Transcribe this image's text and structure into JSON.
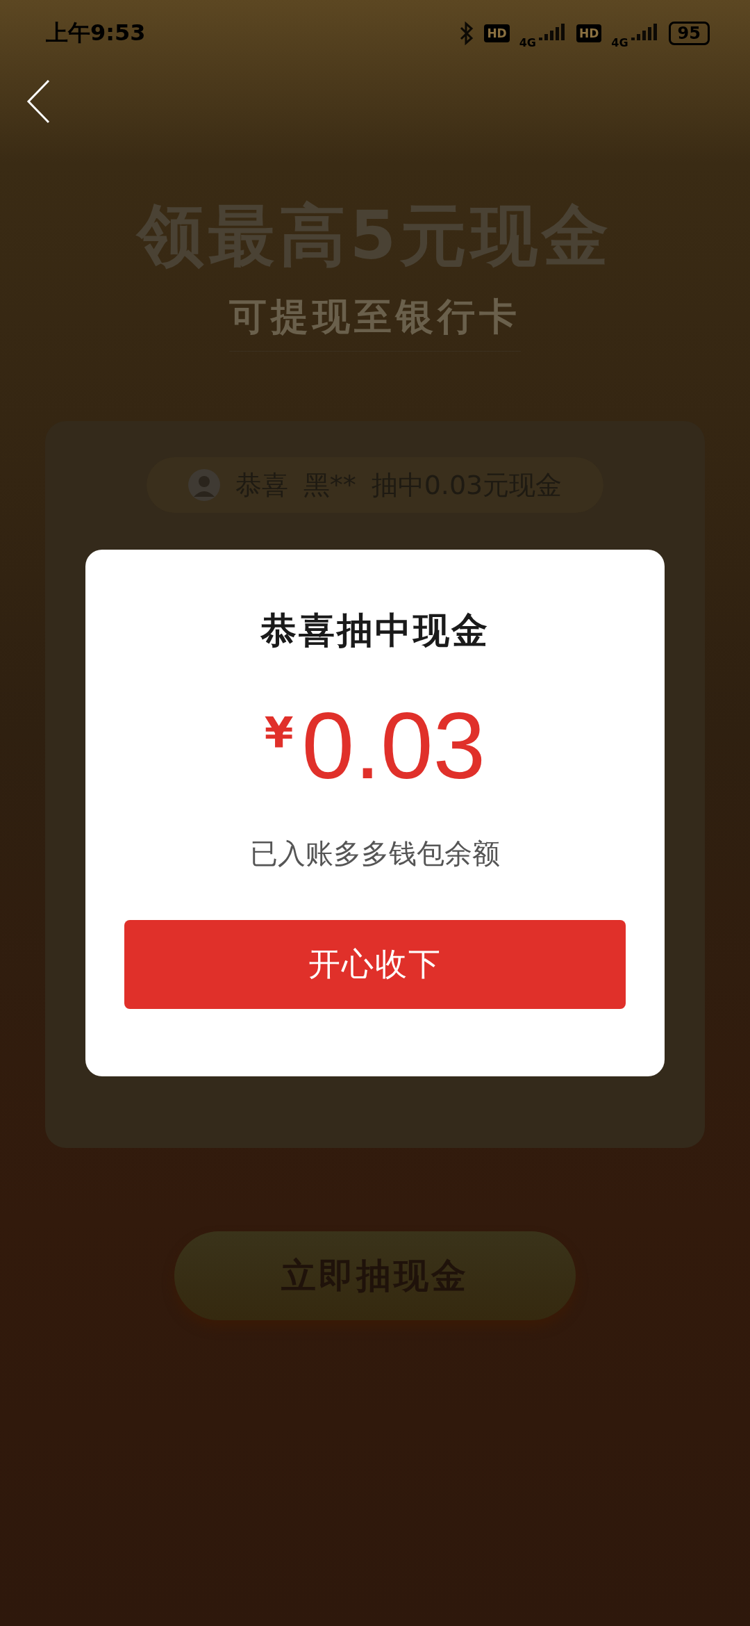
{
  "status_bar": {
    "time": "上午9:53",
    "hd_labels": [
      "HD",
      "HD"
    ],
    "network_labels": [
      "4G",
      "4G"
    ],
    "battery": "95"
  },
  "headline": "领最高5元现金",
  "subheadline": "可提现至银行卡",
  "ticker": {
    "greeting": "恭喜",
    "user": "黑**",
    "message": "抽中0.03元现金"
  },
  "draw_button": "立即抽现金",
  "dialog": {
    "title": "恭喜抽中现金",
    "currency": "¥",
    "amount": "0.03",
    "note": "已入账多多钱包余额",
    "button": "开心收下"
  }
}
